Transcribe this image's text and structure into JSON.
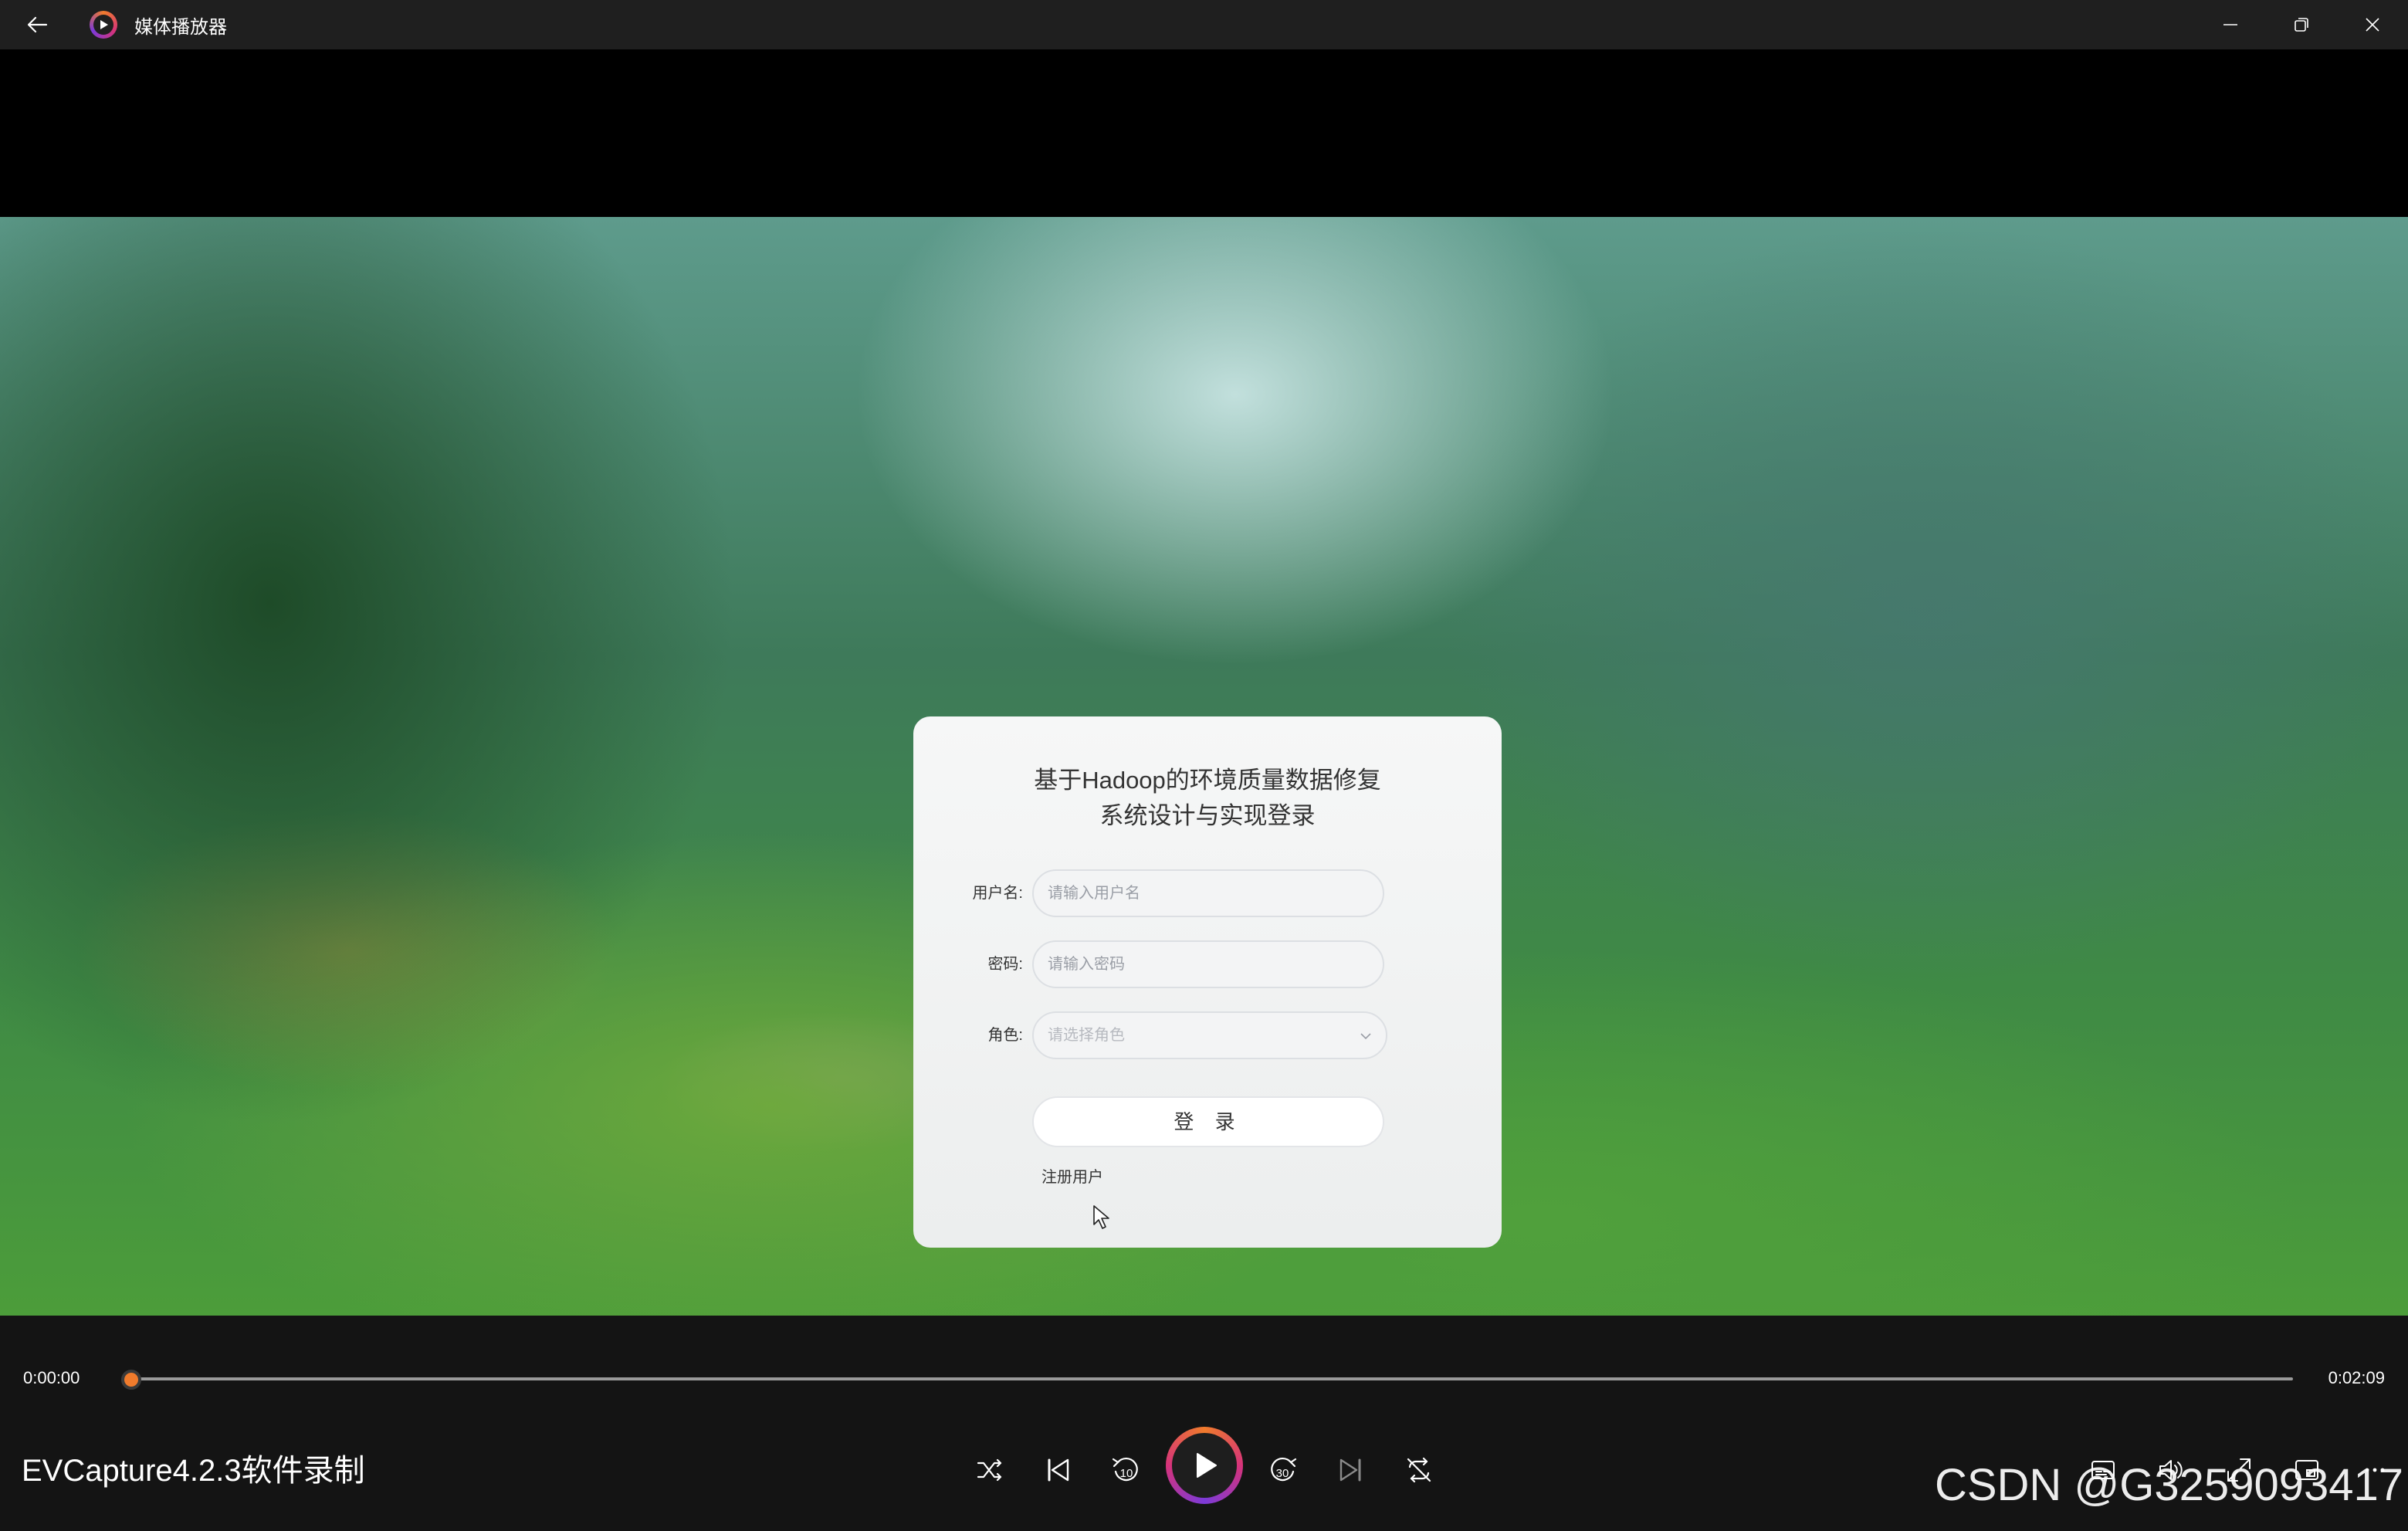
{
  "window": {
    "title": "媒体播放器",
    "icons": {
      "back": "back-arrow-icon",
      "app": "media-player-app-icon",
      "minimize": "minimize-icon",
      "restore": "restore-icon",
      "close": "close-icon"
    }
  },
  "login": {
    "title_line1": "基于Hadoop的环境质量数据修复",
    "title_line2": "系统设计与实现登录",
    "username_label": "用户名:",
    "username_placeholder": "请输入用户名",
    "password_label": "密码:",
    "password_placeholder": "请输入密码",
    "role_label": "角色:",
    "role_placeholder": "请选择角色",
    "login_button": "登 录",
    "register_link": "注册用户"
  },
  "player": {
    "current_time": "0:00:00",
    "total_time": "0:02:09",
    "progress": 0.0,
    "media_title": "EVCapture4.2.3软件录制",
    "accent_color": "#f07b2c",
    "buttons": [
      "shuffle-icon",
      "previous-icon",
      "rewind-10-icon",
      "play-icon",
      "forward-30-icon",
      "next-icon",
      "repeat-icon"
    ],
    "right_buttons": [
      "subtitles-icon",
      "volume-icon",
      "fullscreen-icon",
      "mini-view-icon",
      "more-icon"
    ]
  },
  "watermark": "CSDN @G3259093417"
}
